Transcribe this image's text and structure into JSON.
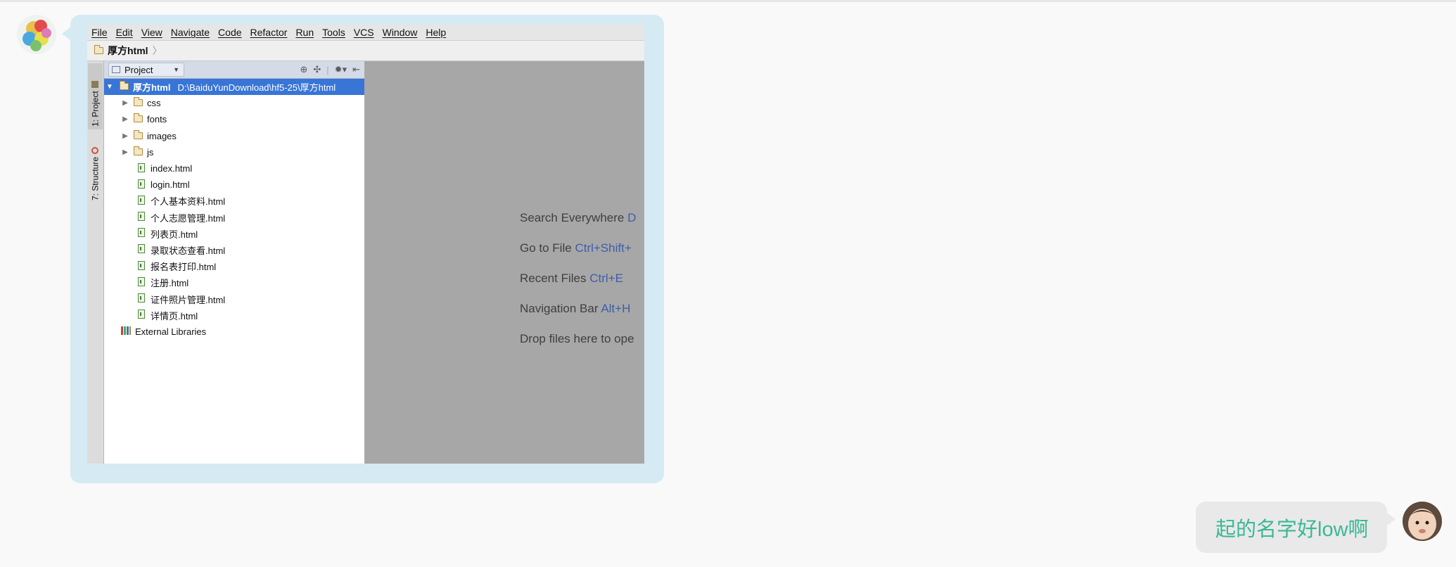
{
  "colors": {
    "page_bg": "#f9f9f9",
    "incoming_bubble": "#d5eaf3",
    "outgoing_bubble": "#e9e9e9",
    "outgoing_text": "#3ab894",
    "selection": "#3875d7",
    "editor_bg": "#a7a7a7",
    "shortcut_blue": "#3d5ea8"
  },
  "menu": [
    "File",
    "Edit",
    "View",
    "Navigate",
    "Code",
    "Refactor",
    "Run",
    "Tools",
    "VCS",
    "Window",
    "Help"
  ],
  "navbar": {
    "project_name": "厚方html",
    "separator": "〉"
  },
  "side_tabs": {
    "project": "1: Project",
    "structure": "7: Structure"
  },
  "panel": {
    "view_selector": "Project",
    "tool_icons": [
      "locate-icon",
      "collapse-icon",
      "gear-icon",
      "hide-icon"
    ]
  },
  "tree": {
    "root": {
      "name": "厚方html",
      "path": "D:\\BaiduYunDownload\\hf5-25\\厚方html"
    },
    "folders": [
      "css",
      "fonts",
      "images",
      "js"
    ],
    "files": [
      "index.html",
      "login.html",
      "个人基本资料.html",
      "个人志愿管理.html",
      "列表页.html",
      "录取状态查看.html",
      "报名表打印.html",
      "注册.html",
      "证件照片管理.html",
      "详情页.html"
    ],
    "libraries": "External Libraries"
  },
  "editor_hints": [
    {
      "label": "Search Everywhere",
      "shortcut": "D"
    },
    {
      "label": "Go to File",
      "shortcut": "Ctrl+Shift+"
    },
    {
      "label": "Recent Files",
      "shortcut": "Ctrl+E"
    },
    {
      "label": "Navigation Bar",
      "shortcut": "Alt+H"
    },
    {
      "label": "Drop files here to ope",
      "shortcut": ""
    }
  ],
  "reply_message": "起的名字好low啊"
}
